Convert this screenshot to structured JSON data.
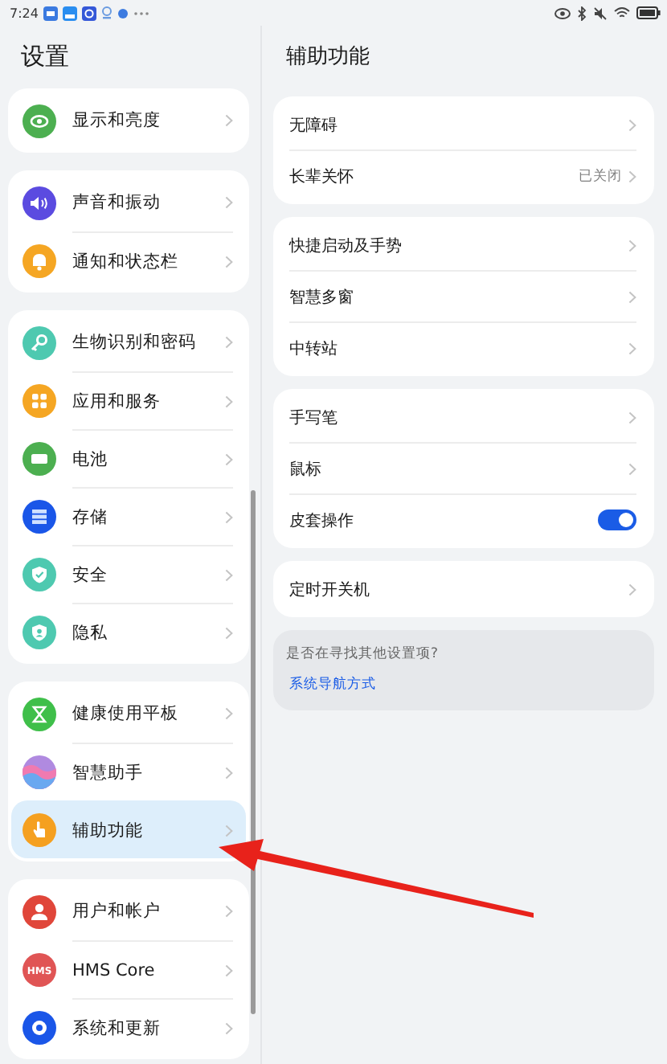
{
  "status_bar": {
    "time": "7:24"
  },
  "sidebar": {
    "title": "设置",
    "groups": [
      {
        "items": [
          {
            "label": "显示和亮度",
            "color": "#4caf50",
            "selected": false
          }
        ]
      },
      {
        "items": [
          {
            "label": "声音和振动",
            "color": "#5b4be0",
            "selected": false
          },
          {
            "label": "通知和状态栏",
            "color": "#f5a623",
            "selected": false
          }
        ]
      },
      {
        "items": [
          {
            "label": "生物识别和密码",
            "color": "#4ec9b0",
            "selected": false
          },
          {
            "label": "应用和服务",
            "color": "#f5a623",
            "selected": false
          },
          {
            "label": "电池",
            "color": "#4caf50",
            "selected": false
          },
          {
            "label": "存储",
            "color": "#1a56e8",
            "selected": false
          },
          {
            "label": "安全",
            "color": "#4ec9b0",
            "selected": false
          },
          {
            "label": "隐私",
            "color": "#4ec9b0",
            "selected": false
          }
        ]
      },
      {
        "items": [
          {
            "label": "健康使用平板",
            "color": "#3fbf4a",
            "selected": false
          },
          {
            "label": "智慧助手",
            "color": "#b08ae0",
            "selected": false
          },
          {
            "label": "辅助功能",
            "color": "#f5a020",
            "selected": true
          }
        ]
      },
      {
        "items": [
          {
            "label": "用户和帐户",
            "color": "#e0463a",
            "selected": false
          },
          {
            "label": "HMS Core",
            "color": "#e05555",
            "icon_text": "HMS",
            "selected": false
          },
          {
            "label": "系统和更新",
            "color": "#1a56e8",
            "selected": false
          }
        ]
      }
    ]
  },
  "detail": {
    "title": "辅助功能",
    "groups": [
      {
        "rows": [
          {
            "kind": "link",
            "label": "无障碍"
          },
          {
            "kind": "link",
            "label": "长辈关怀",
            "value": "已关闭"
          }
        ]
      },
      {
        "rows": [
          {
            "kind": "link",
            "label": "快捷启动及手势"
          },
          {
            "kind": "link",
            "label": "智慧多窗"
          },
          {
            "kind": "link",
            "label": "中转站"
          }
        ]
      },
      {
        "rows": [
          {
            "kind": "link",
            "label": "手写笔"
          },
          {
            "kind": "link",
            "label": "鼠标"
          },
          {
            "kind": "toggle",
            "label": "皮套操作",
            "on": true
          }
        ]
      },
      {
        "rows": [
          {
            "kind": "link",
            "label": "定时开关机"
          }
        ]
      }
    ],
    "suggestion": {
      "question": "是否在寻找其他设置项?",
      "link": "系统导航方式"
    }
  }
}
